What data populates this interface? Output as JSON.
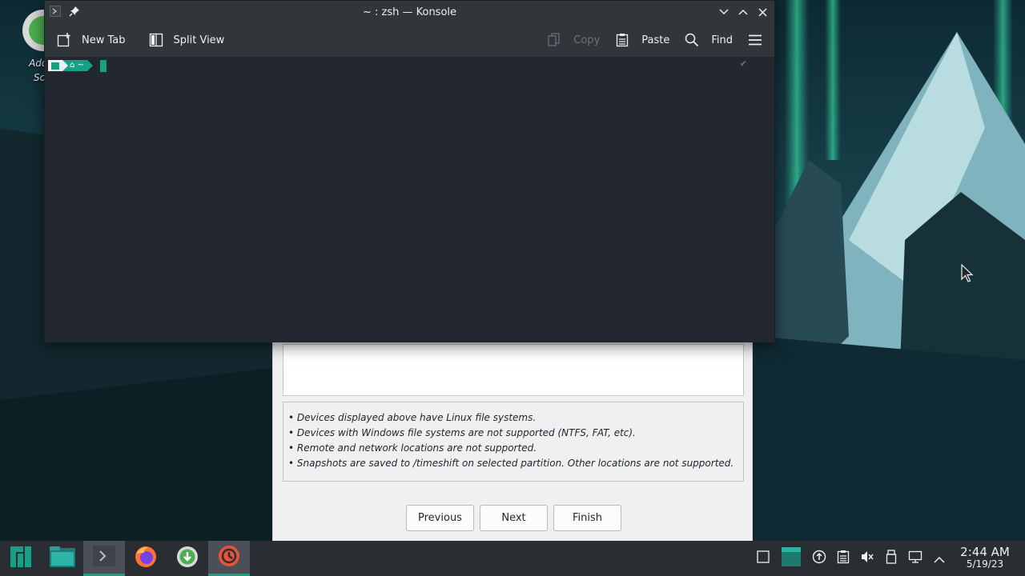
{
  "desktop": {
    "icon_label_line1": "Add/R",
    "icon_label_line2": "Soft"
  },
  "konsole": {
    "title": "~ : zsh — Konsole",
    "toolbar": {
      "new_tab": "New Tab",
      "split_view": "Split View",
      "copy": "Copy",
      "paste": "Paste",
      "find": "Find"
    },
    "prompt_path": "~",
    "status_mark": "✔"
  },
  "timeshift": {
    "notes": [
      "• Devices displayed above have Linux file systems.",
      "• Devices with Windows file systems are not supported (NTFS, FAT, etc).",
      "• Remote and network locations are not supported.",
      "• Snapshots are saved to /timeshift on selected partition. Other locations are not supported."
    ],
    "buttons": {
      "previous": "Previous",
      "next": "Next",
      "finish": "Finish"
    }
  },
  "taskbar": {
    "clock_time": "2:44 AM",
    "clock_date": "5/19/23",
    "apps": [
      "manjaro-menu-icon",
      "file-manager-icon",
      "konsole-icon",
      "firefox-icon",
      "software-installer-icon",
      "timeshift-icon"
    ],
    "accent_color": "#16a085"
  }
}
